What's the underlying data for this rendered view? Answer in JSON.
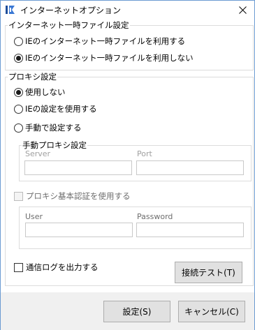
{
  "window": {
    "title": "インターネットオプション"
  },
  "temp_files": {
    "group_title": "インターネット一時ファイル設定",
    "options": [
      {
        "label": "IEのインターネット一時ファイルを利用する",
        "selected": false
      },
      {
        "label": "IEのインターネット一時ファイルを利用しない",
        "selected": true
      }
    ]
  },
  "proxy": {
    "group_title": "プロキシ設定",
    "options": [
      {
        "label": "使用しない",
        "selected": true
      },
      {
        "label": "IEの設定を使用する",
        "selected": false
      },
      {
        "label": "手動で設定する",
        "selected": false
      }
    ],
    "manual": {
      "group_title": "手動プロキシ設定",
      "server_label": "Server",
      "server_value": "",
      "port_label": "Port",
      "port_value": ""
    },
    "auth": {
      "checkbox_label": "プロキシ基本認証を使用する",
      "checked": false,
      "user_label": "User",
      "user_value": "",
      "password_label": "Password",
      "password_value": ""
    }
  },
  "log": {
    "checkbox_label": "通信ログを出力する",
    "checked": false
  },
  "buttons": {
    "test": "接続テスト(T)",
    "ok": "設定(S)",
    "cancel": "キャンセル(C)"
  }
}
